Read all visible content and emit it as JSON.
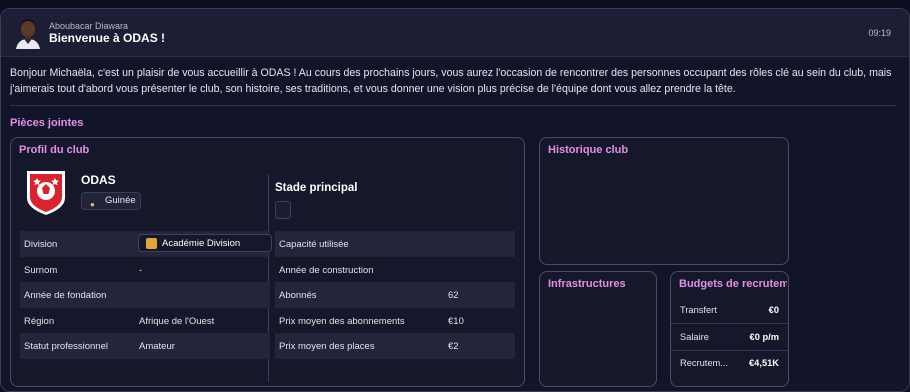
{
  "header": {
    "sender": "Aboubacar Diawara",
    "subject": "Bienvenue à ODAS !",
    "time": "09:19"
  },
  "message": "Bonjour Michaëla, c'est un plaisir de vous accueillir à ODAS ! Au cours des prochains jours, vous aurez l'occasion de rencontrer des personnes occupant des rôles clé au sein du club, mais j'aimerais tout d'abord vous présenter le club, son histoire, ses traditions, et vous donner une vision plus précise de l'équipe dont vous allez prendre la tête.",
  "attachments_title": "Pièces jointes",
  "club_profile": {
    "title": "Profil du club",
    "name": "ODAS",
    "country": "Guinée",
    "rows": [
      {
        "label": "Division",
        "value": "Académie Division"
      },
      {
        "label": "Surnom",
        "value": "-"
      },
      {
        "label": "Année de fondation",
        "value": ""
      },
      {
        "label": "Région",
        "value": "Afrique de l'Ouest"
      },
      {
        "label": "Statut professionnel",
        "value": "Amateur"
      }
    ],
    "stadium": {
      "title": "Stade principal",
      "rows": [
        {
          "label": "Capacité utilisée",
          "value": ""
        },
        {
          "label": "Année de construction",
          "value": ""
        },
        {
          "label": "Abonnés",
          "value": "62"
        },
        {
          "label": "Prix moyen des abonnements",
          "value": "€10"
        },
        {
          "label": "Prix moyen des places",
          "value": "€2"
        }
      ]
    }
  },
  "history": {
    "title": "Historique club"
  },
  "infrastructure": {
    "title": "Infrastructures"
  },
  "budgets": {
    "title": "Budgets de recruteme",
    "rows": [
      {
        "label": "Transfert",
        "value": "€0"
      },
      {
        "label": "Salaire",
        "value": "€0 p/m"
      },
      {
        "label": "Recrutem...",
        "value": "€4,51K"
      }
    ]
  },
  "colors": {
    "accent": "#e58ee6",
    "background": "#12152a",
    "crest_red": "#d9232e"
  }
}
